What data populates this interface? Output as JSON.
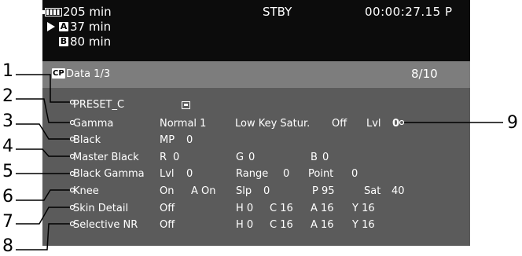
{
  "header": {
    "battery_time": "205 min",
    "status": "STBY",
    "timecode": "00:00:27.15 P",
    "card_a": {
      "letter": "A",
      "time": "37 min"
    },
    "card_b": {
      "letter": "B",
      "time": "80 min"
    },
    "icons": {
      "battery": "battery-icon",
      "play": "play-triangle-icon"
    }
  },
  "cp_bar": {
    "icon_label": "CP",
    "title": "Data 1/3",
    "page": "8/10"
  },
  "preset": {
    "name": "PRESET_C",
    "lock_icon": "key-protect-icon"
  },
  "rows": [
    {
      "label": "Gamma",
      "v1": "Normal 1",
      "v2": "Low Key Satur.",
      "v3": "Off",
      "v4": "Lvl",
      "v5": "0"
    },
    {
      "label": "Black",
      "v1": "MP",
      "v2": "0"
    },
    {
      "label": "Master Black",
      "v1": "R",
      "v2": "0",
      "v3": "G",
      "v4": "0",
      "v5": "B",
      "v6": "0"
    },
    {
      "label": "Black Gamma",
      "v1": "Lvl",
      "v2": "0",
      "v3": "Range",
      "v4": "0",
      "v5": "Point",
      "v6": "0"
    },
    {
      "label": "Knee",
      "v1": "On",
      "v2": "A On",
      "v3": "Slp",
      "v4": "0",
      "v5": "P 95",
      "v6": "Sat",
      "v7": "40"
    },
    {
      "label": "Skin Detail",
      "v1": "Off",
      "v2": "H 0",
      "v3": "C 16",
      "v4": "A 16",
      "v5": "Y 16"
    },
    {
      "label": "Selective NR",
      "v1": "Off",
      "v2": "H 0",
      "v3": "C 16",
      "v4": "A 16",
      "v5": "Y 16"
    }
  ],
  "callouts": [
    "1",
    "2",
    "3",
    "4",
    "5",
    "6",
    "7",
    "8",
    "9"
  ],
  "colors": {
    "screen_bg": "#5b5b5b",
    "top_bg": "#0c0c0c",
    "cp_bg": "#7d7d7d",
    "text": "#ffffff"
  }
}
